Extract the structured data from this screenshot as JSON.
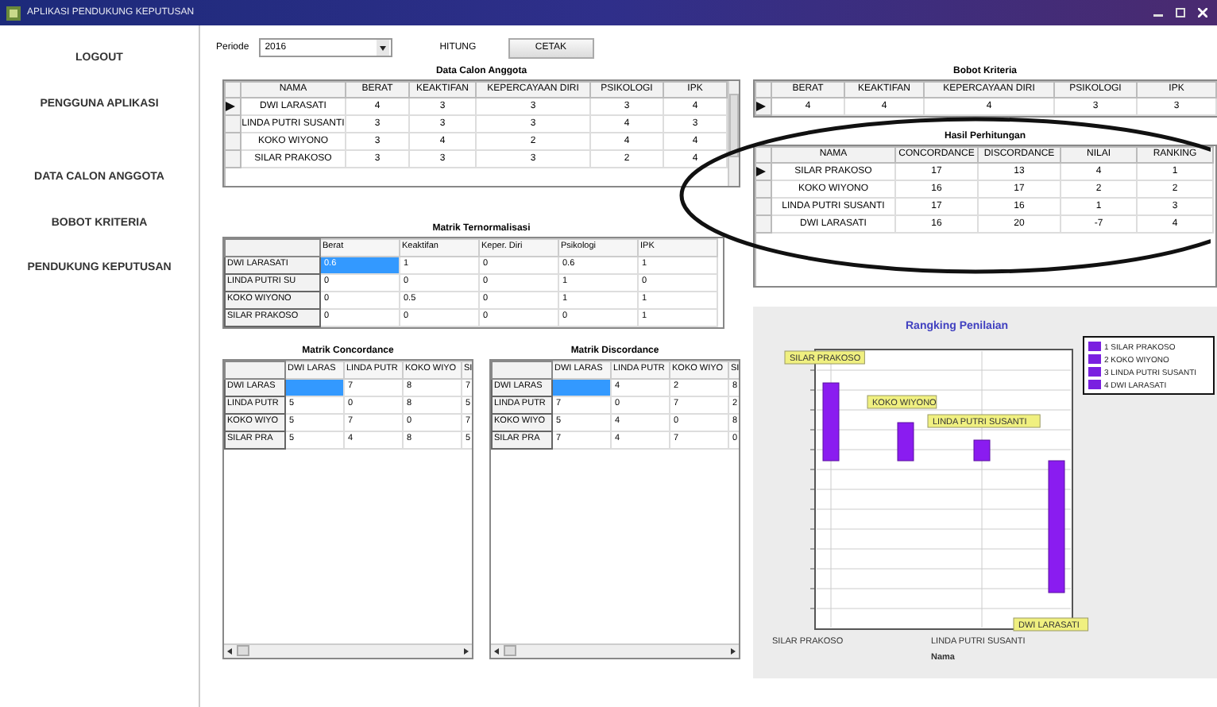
{
  "window": {
    "title": "APLIKASI PENDUKUNG KEPUTUSAN"
  },
  "sidebar": {
    "items": [
      "LOGOUT",
      "PENGGUNA APLIKASI",
      "DATA CALON ANGGOTA",
      "BOBOT KRITERIA",
      "PENDUKUNG KEPUTUSAN"
    ]
  },
  "toolbar": {
    "period_label": "Periode",
    "period_value": "2016",
    "count_label": "HITUNG",
    "print_button": "CETAK"
  },
  "candidates": {
    "title": "Data Calon Anggota",
    "columns": [
      "NAMA",
      "BERAT",
      "KEAKTIFAN",
      "KEPERCAYAAN DIRI",
      "PSIKOLOGI",
      "IPK"
    ],
    "rows": [
      {
        "selected": true,
        "cells": [
          "DWI LARASATI",
          "4",
          "3",
          "3",
          "3",
          "4"
        ]
      },
      {
        "selected": false,
        "cells": [
          "LINDA PUTRI SUSANTI",
          "3",
          "3",
          "3",
          "4",
          "3"
        ]
      },
      {
        "selected": false,
        "cells": [
          "KOKO WIYONO",
          "3",
          "4",
          "2",
          "4",
          "4"
        ]
      },
      {
        "selected": false,
        "cells": [
          "SILAR PRAKOSO",
          "3",
          "3",
          "3",
          "2",
          "4"
        ]
      }
    ]
  },
  "criteria_weights": {
    "title": "Bobot Kriteria",
    "columns": [
      "BERAT",
      "KEAKTIFAN",
      "KEPERCAYAAN DIRI",
      "PSIKOLOGI",
      "IPK"
    ],
    "rows": [
      {
        "selected": true,
        "cells": [
          "4",
          "4",
          "4",
          "3",
          "3"
        ]
      }
    ]
  },
  "results": {
    "title": "Hasil Perhitungan",
    "columns": [
      "NAMA",
      "CONCORDANCE",
      "DISCORDANCE",
      "NILAI",
      "RANKING"
    ],
    "rows": [
      {
        "selected": true,
        "cells": [
          "SILAR PRAKOSO",
          "17",
          "13",
          "4",
          "1"
        ]
      },
      {
        "selected": false,
        "cells": [
          "KOKO WIYONO",
          "16",
          "17",
          "2",
          "2"
        ]
      },
      {
        "selected": false,
        "cells": [
          "LINDA PUTRI SUSANTI",
          "17",
          "16",
          "1",
          "3"
        ]
      },
      {
        "selected": false,
        "cells": [
          "DWI LARASATI",
          "16",
          "20",
          "-7",
          "4"
        ]
      }
    ]
  },
  "normalized": {
    "title": "Matrik Ternormalisasi",
    "columns": [
      "Berat",
      "Keaktifan",
      "Keper. Diri",
      "Psikologi",
      "IPK"
    ],
    "rows": [
      {
        "name": "DWI LARASATI",
        "selected": true,
        "values": [
          "0.6",
          "1",
          "0",
          "0.6",
          "1"
        ]
      },
      {
        "name": "LINDA PUTRI SU",
        "selected": false,
        "values": [
          "0",
          "0",
          "0",
          "1",
          "0"
        ]
      },
      {
        "name": "KOKO WIYONO",
        "selected": false,
        "values": [
          "0",
          "0.5",
          "0",
          "1",
          "1"
        ]
      },
      {
        "name": "SILAR PRAKOSO",
        "selected": false,
        "values": [
          "0",
          "0",
          "0",
          "0",
          "1"
        ]
      }
    ]
  },
  "concordance": {
    "title": "Matrik Concordance",
    "columns": [
      "DWI LARAS",
      "LINDA PUTR",
      "KOKO WIYO",
      "SI"
    ],
    "rows": [
      {
        "name": "DWI LARAS",
        "selected": true,
        "values": [
          "7",
          "8",
          "7"
        ]
      },
      {
        "name": "LINDA PUTR",
        "selected": false,
        "values": [
          "5",
          "0",
          "8",
          "5"
        ]
      },
      {
        "name": "KOKO WIYO",
        "selected": false,
        "values": [
          "5",
          "7",
          "0",
          "7"
        ]
      },
      {
        "name": "SILAR PRA",
        "selected": false,
        "values": [
          "5",
          "4",
          "8",
          "5"
        ]
      }
    ]
  },
  "discordance": {
    "title": "Matrik Discordance",
    "columns": [
      "DWI LARAS",
      "LINDA PUTR",
      "KOKO WIYO",
      "SI"
    ],
    "rows": [
      {
        "name": "DWI LARAS",
        "selected": true,
        "values": [
          "4",
          "2",
          "8"
        ]
      },
      {
        "name": "LINDA PUTR",
        "selected": false,
        "values": [
          "7",
          "0",
          "7",
          "2"
        ]
      },
      {
        "name": "KOKO WIYO",
        "selected": false,
        "values": [
          "5",
          "4",
          "0",
          "8"
        ]
      },
      {
        "name": "SILAR PRA",
        "selected": false,
        "values": [
          "7",
          "4",
          "7",
          "0"
        ]
      }
    ]
  },
  "chart": {
    "title": "Rangking Penilaian",
    "xlabel": "Nama",
    "x_labels": [
      "SILAR PRAKOSO",
      "LINDA PUTRI SUSANTI"
    ],
    "bar_labels": [
      "SILAR PRAKOSO",
      "KOKO WIYONO",
      "LINDA PUTRI SUSANTI",
      "DWI LARASATI"
    ],
    "legend": [
      "1 SILAR PRAKOSO",
      "2 KOKO WIYONO",
      "3 LINDA PUTRI SUSANTI",
      "4 DWI LARASATI"
    ]
  }
}
